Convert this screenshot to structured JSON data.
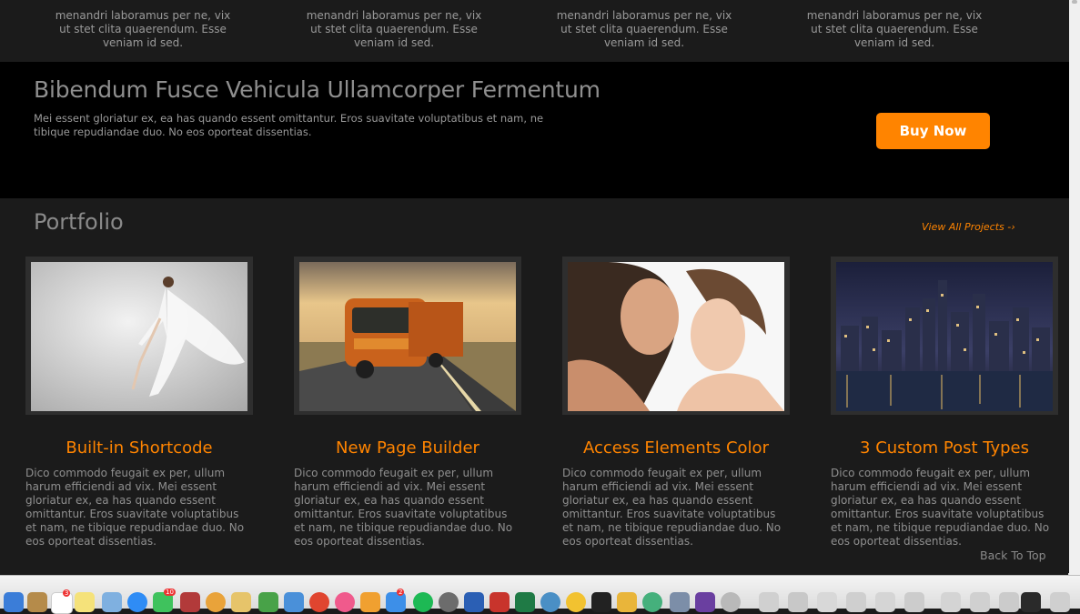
{
  "features": [
    {
      "text": "menandri laboramus per ne, vix ut stet clita quaerendum. Esse veniam id sed."
    },
    {
      "text": "menandri laboramus per ne, vix ut stet clita quaerendum. Esse veniam id sed."
    },
    {
      "text": "menandri laboramus per ne, vix ut stet clita quaerendum. Esse veniam id sed."
    },
    {
      "text": "menandri laboramus per ne, vix ut stet clita quaerendum. Esse veniam id sed."
    }
  ],
  "cta": {
    "title": "Bibendum Fusce Vehicula Ullamcorper Fermentum",
    "text": "Mei essent gloriatur ex, ea has quando essent omittantur. Eros suavitate voluptatibus et nam, ne tibique repudiandae duo. No eos oporteat dissentias.",
    "button_label": "Buy Now"
  },
  "portfolio": {
    "title": "Portfolio",
    "view_all": "View All Projects -›",
    "items": [
      {
        "title": "Built-in Shortcode",
        "text": "Dico commodo feugait ex per, ullum harum efficiendi ad vix. Mei essent gloriatur ex, ea has quando essent omittantur. Eros suavitate voluptatibus et nam, ne tibique repudiandae duo. No eos oporteat dissentias."
      },
      {
        "title": "New Page Builder",
        "text": "Dico commodo feugait ex per, ullum harum efficiendi ad vix. Mei essent gloriatur ex, ea has quando essent omittantur. Eros suavitate voluptatibus et nam, ne tibique repudiandae duo. No eos oporteat dissentias."
      },
      {
        "title": "Access Elements Color",
        "text": "Dico commodo feugait ex per, ullum harum efficiendi ad vix. Mei essent gloriatur ex, ea has quando essent omittantur. Eros suavitate voluptatibus et nam, ne tibique repudiandae duo. No eos oporteat dissentias."
      },
      {
        "title": "3 Custom Post Types",
        "text": "Dico commodo feugait ex per, ullum harum efficiendi ad vix. Mei essent gloriatur ex, ea has quando essent omittantur. Eros suavitate voluptatibus et nam, ne tibique repudiandae duo. No eos oporteat dissentias."
      }
    ],
    "back_to_top": "Back To Top"
  },
  "colors": {
    "accent": "#ff8400",
    "page_background": "#1b1b1b",
    "cta_background": "#000000",
    "muted_text": "#8f8f8f"
  },
  "dock": {
    "badges": [
      "3",
      "10",
      "2"
    ]
  }
}
